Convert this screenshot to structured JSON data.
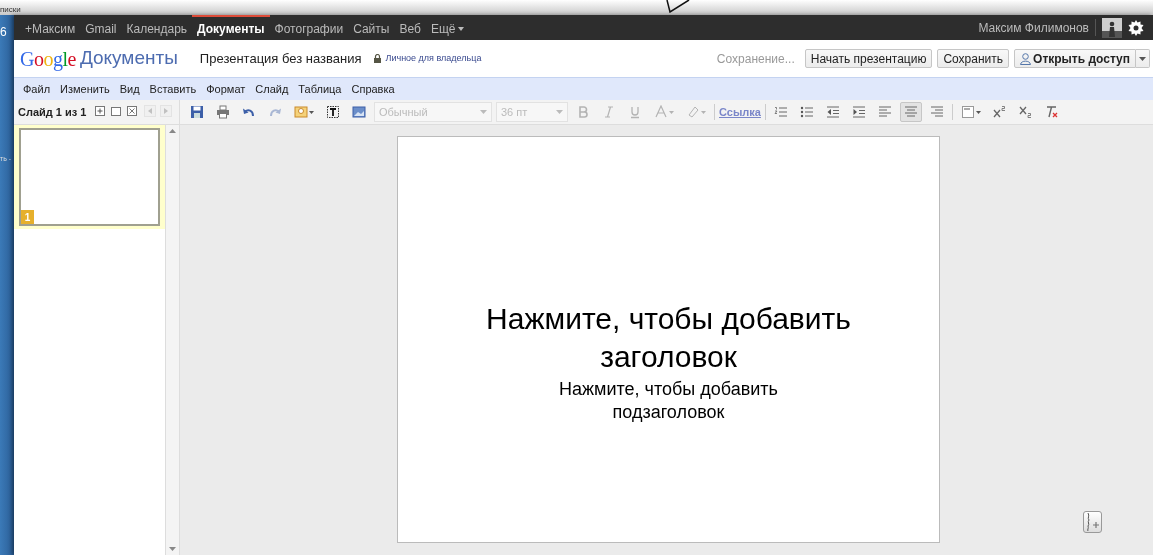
{
  "background_window": {
    "texts": [
      "писки",
      "6",
      "ть -"
    ]
  },
  "google_bar": {
    "items": [
      {
        "label": "+Максим",
        "selected": false
      },
      {
        "label": "Gmail",
        "selected": false
      },
      {
        "label": "Календарь",
        "selected": false
      },
      {
        "label": "Документы",
        "selected": true
      },
      {
        "label": "Фотографии",
        "selected": false
      },
      {
        "label": "Сайты",
        "selected": false
      },
      {
        "label": "Веб",
        "selected": false
      },
      {
        "label": "Ещё",
        "selected": false,
        "dropdown": true
      }
    ],
    "user_name": "Максим Филимонов"
  },
  "header": {
    "logo_brand": "Google",
    "logo_product": "Документы",
    "document_title": "Презентация без названия",
    "privacy": "Личное для владельца",
    "save_status": "Сохранение...",
    "buttons": [
      {
        "label": "Начать презентацию",
        "kind": "plain"
      },
      {
        "label": "Сохранить",
        "kind": "plain"
      },
      {
        "label": "Открыть доступ",
        "kind": "share"
      }
    ]
  },
  "menu": [
    "Файл",
    "Изменить",
    "Вид",
    "Вставить",
    "Формат",
    "Слайд",
    "Таблица",
    "Справка"
  ],
  "slide_counter": "Слайд 1 из 1",
  "slide_tools": [
    {
      "kind": "add",
      "disabled": false
    },
    {
      "kind": "duplicate",
      "disabled": false
    },
    {
      "kind": "delete",
      "disabled": false
    },
    {
      "kind": "prev",
      "disabled": true
    },
    {
      "kind": "next",
      "disabled": true
    }
  ],
  "toolbar": [
    {
      "kind": "save",
      "disabled": false,
      "selected": false
    },
    {
      "kind": "print",
      "disabled": false,
      "selected": false
    },
    {
      "kind": "undo",
      "disabled": false,
      "selected": false
    },
    {
      "kind": "redo",
      "disabled": true,
      "selected": false
    },
    {
      "kind": "shape",
      "disabled": false,
      "selected": false
    },
    {
      "kind": "textbox",
      "disabled": false,
      "selected": false
    },
    {
      "kind": "image",
      "disabled": false,
      "selected": false
    },
    {
      "kind": "dropdown",
      "value": "Обычный",
      "disabled": true
    },
    {
      "kind": "dropdown",
      "value": "36 пт",
      "disabled": true
    },
    {
      "kind": "bold",
      "disabled": true,
      "selected": false
    },
    {
      "kind": "italic",
      "disabled": true,
      "selected": false
    },
    {
      "kind": "underline",
      "disabled": true,
      "selected": false
    },
    {
      "kind": "text-color",
      "disabled": true,
      "selected": false
    },
    {
      "kind": "highlight",
      "disabled": true,
      "selected": false
    },
    {
      "kind": "link",
      "label": "Ссылка",
      "disabled": false,
      "selected": false
    },
    {
      "kind": "numbered-list",
      "disabled": false,
      "selected": false
    },
    {
      "kind": "bullet-list",
      "disabled": false,
      "selected": false
    },
    {
      "kind": "outdent",
      "disabled": false,
      "selected": false
    },
    {
      "kind": "indent",
      "disabled": false,
      "selected": false
    },
    {
      "kind": "align-left",
      "disabled": false,
      "selected": false
    },
    {
      "kind": "align-center",
      "disabled": false,
      "selected": true
    },
    {
      "kind": "align-right",
      "disabled": false,
      "selected": false
    },
    {
      "kind": "vertical-align",
      "disabled": false,
      "selected": false
    },
    {
      "kind": "superscript",
      "disabled": false,
      "selected": false
    },
    {
      "kind": "subscript",
      "disabled": false,
      "selected": false
    },
    {
      "kind": "clear-format",
      "disabled": false,
      "selected": false
    }
  ],
  "thumbnails": [
    {
      "number": "1",
      "selected": true
    }
  ],
  "slide": {
    "title_placeholder": "Нажмите, чтобы добавить заголовок",
    "subtitle_placeholder": "Нажмите, чтобы добавить подзаголовок"
  }
}
